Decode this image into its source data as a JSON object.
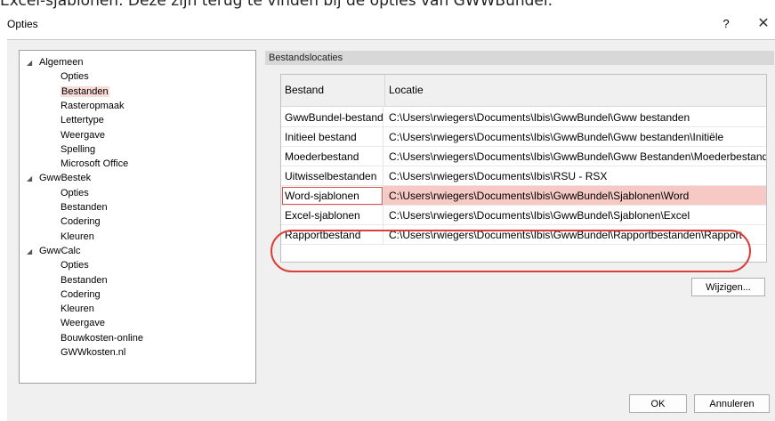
{
  "banner": "Excel-sjablonen. Deze zijn terug te vinden bij de opties van GWWBundel.",
  "window": {
    "title": "Opties",
    "help_label": "?",
    "close_label": "✕"
  },
  "tree": [
    {
      "label": "Algemeen",
      "type": "parent",
      "expanded": true
    },
    {
      "label": "Opties",
      "type": "child"
    },
    {
      "label": "Bestanden",
      "type": "child",
      "selected": true
    },
    {
      "label": "Rasteropmaak",
      "type": "child"
    },
    {
      "label": "Lettertype",
      "type": "child"
    },
    {
      "label": "Weergave",
      "type": "child"
    },
    {
      "label": "Spelling",
      "type": "child"
    },
    {
      "label": "Microsoft Office",
      "type": "child"
    },
    {
      "label": "GwwBestek",
      "type": "parent",
      "expanded": true
    },
    {
      "label": "Opties",
      "type": "child"
    },
    {
      "label": "Bestanden",
      "type": "child"
    },
    {
      "label": "Codering",
      "type": "child"
    },
    {
      "label": "Kleuren",
      "type": "child"
    },
    {
      "label": "GwwCalc",
      "type": "parent",
      "expanded": true
    },
    {
      "label": "Opties",
      "type": "child"
    },
    {
      "label": "Bestanden",
      "type": "child"
    },
    {
      "label": "Codering",
      "type": "child"
    },
    {
      "label": "Kleuren",
      "type": "child"
    },
    {
      "label": "Weergave",
      "type": "child"
    },
    {
      "label": "Bouwkosten-online",
      "type": "child"
    },
    {
      "label": "GWWkosten.nl",
      "type": "child"
    }
  ],
  "section_title": "Bestandslocaties",
  "table": {
    "headers": [
      "Bestand",
      "Locatie"
    ],
    "rows": [
      {
        "bestand": "GwwBundel-bestanden",
        "locatie": "C:\\Users\\rwiegers\\Documents\\Ibis\\GwwBundel\\Gww bestanden"
      },
      {
        "bestand": "Initieel bestand",
        "locatie": "C:\\Users\\rwiegers\\Documents\\Ibis\\GwwBundel\\Gww bestanden\\Initiële"
      },
      {
        "bestand": "Moederbestand",
        "locatie": "C:\\Users\\rwiegers\\Documents\\Ibis\\GwwBundel\\Gww Bestanden\\Moederbestand"
      },
      {
        "bestand": "Uitwisselbestanden",
        "locatie": "C:\\Users\\rwiegers\\Documents\\Ibis\\RSU - RSX"
      },
      {
        "bestand": "Word-sjablonen",
        "locatie": "C:\\Users\\rwiegers\\Documents\\Ibis\\GwwBundel\\Sjablonen\\Word",
        "highlight": true
      },
      {
        "bestand": "Excel-sjablonen",
        "locatie": "C:\\Users\\rwiegers\\Documents\\Ibis\\GwwBundel\\Sjablonen\\Excel"
      },
      {
        "bestand": "Rapportbestand",
        "locatie": "C:\\Users\\rwiegers\\Documents\\Ibis\\GwwBundel\\Rapportbestanden\\Rapport"
      }
    ]
  },
  "buttons": {
    "wijzigen": "Wijzigen...",
    "ok": "OK",
    "annuleren": "Annuleren"
  },
  "colors": {
    "annotation": "#d9403a",
    "selected_bg": "#f6c9c5"
  }
}
